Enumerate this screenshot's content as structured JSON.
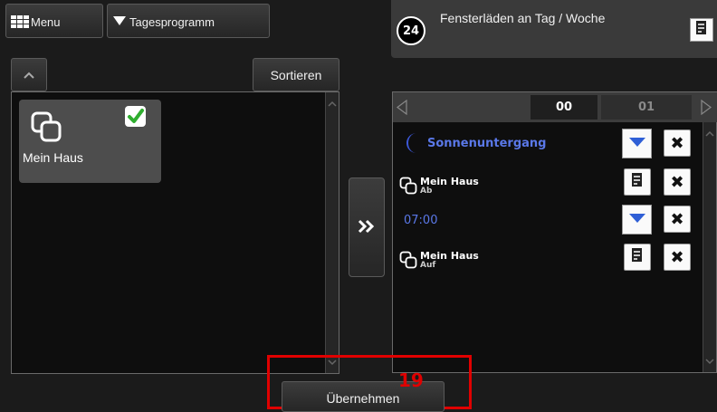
{
  "header": {
    "menu_label": "Menu",
    "program_label": "Tagesprogramm"
  },
  "left_panel": {
    "sort_label": "Sortieren",
    "items": [
      {
        "label": "Mein Haus",
        "checked": true
      }
    ]
  },
  "transfer_button_label": "»",
  "schedule": {
    "clock_label": "24",
    "title": "Fensterläden an Tag / Woche",
    "hours": [
      "00",
      "01"
    ],
    "entries": [
      {
        "kind": "time",
        "label": "Sonnenuntergang",
        "icon": "moon-icon"
      },
      {
        "kind": "action",
        "title": "Mein Haus",
        "subtitle": "Ab",
        "icon": "house-group-icon"
      },
      {
        "kind": "time",
        "label": "07:00"
      },
      {
        "kind": "action",
        "title": "Mein Haus",
        "subtitle": "Auf",
        "icon": "house-group-icon"
      }
    ]
  },
  "annotation": {
    "number": "19",
    "color": "#e00000"
  },
  "apply_button_label": "Übernehmen"
}
